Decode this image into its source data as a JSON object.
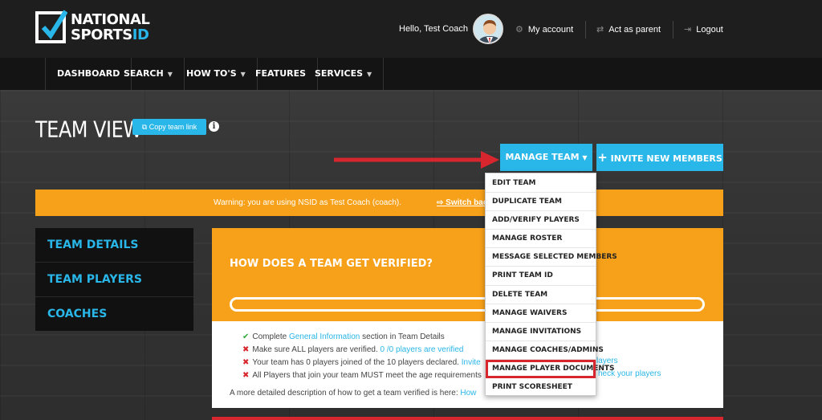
{
  "header": {
    "logo_line1": "NATIONAL",
    "logo_line2a": "SPORTS",
    "logo_line2b": "ID",
    "greeting": "Hello, Test Coach",
    "my_account": "My account",
    "act_as_parent": "Act as parent",
    "logout": "Logout"
  },
  "nav": {
    "items": [
      {
        "label": "DASHBOARD"
      },
      {
        "label": "SEARCH"
      },
      {
        "label": "HOW TO'S"
      },
      {
        "label": "FEATURES"
      },
      {
        "label": "SERVICES"
      }
    ]
  },
  "page": {
    "title": "TEAM VIEW",
    "copy_link": "Copy team link",
    "info": "i"
  },
  "actions": {
    "manage_team": "MANAGE TEAM",
    "invite": "INVITE NEW MEMBERS"
  },
  "warning": {
    "text": "Warning: you are using NSID as Test Coach (coach).",
    "link": "Switch back to Test"
  },
  "sidebar": {
    "items": [
      {
        "label": "TEAM DETAILS"
      },
      {
        "label": "TEAM PLAYERS"
      },
      {
        "label": "COACHES"
      }
    ]
  },
  "verify": {
    "title": "HOW DOES A TEAM GET VERIFIED?",
    "items": [
      {
        "prefix": "Complete ",
        "link": "General Information",
        "suffix": " section in Team Details",
        "status": "ok"
      },
      {
        "prefix": "Make sure ALL players are verified. ",
        "link": "0 /0 players are verified",
        "suffix": "",
        "status": "bad"
      },
      {
        "prefix": "Your team has 0 players joined of the 10 players declared. ",
        "link": "Invite",
        "suffix": "",
        "status": "bad"
      },
      {
        "prefix": "All Players that join your team MUST meet the age requirements",
        "link": "",
        "suffix": "",
        "status": "bad"
      }
    ],
    "detail_prefix": "A more detailed description of how to get a team verified is here: ",
    "detail_link": "How",
    "overflow_link_1": "layers",
    "overflow_link_2": "heck your players"
  },
  "dropdown": {
    "items": [
      {
        "label": "EDIT TEAM"
      },
      {
        "label": "DUPLICATE TEAM"
      },
      {
        "label": "ADD/VERIFY PLAYERS"
      },
      {
        "label": "MANAGE ROSTER"
      },
      {
        "label": "MESSAGE SELECTED MEMBERS"
      },
      {
        "label": "PRINT TEAM ID"
      },
      {
        "label": "DELETE TEAM"
      },
      {
        "label": "MANAGE WAIVERS"
      },
      {
        "label": "MANAGE INVITATIONS"
      },
      {
        "label": "MANAGE COACHES/ADMINS"
      },
      {
        "label": "MANAGE PLAYER DOCUMENTS"
      },
      {
        "label": "PRINT SCORESHEET"
      }
    ],
    "highlighted_index": 10
  },
  "colors": {
    "accent": "#29b6e8",
    "warning": "#f7a11a",
    "highlight": "#d7262e",
    "ok": "#2eaa3c"
  }
}
